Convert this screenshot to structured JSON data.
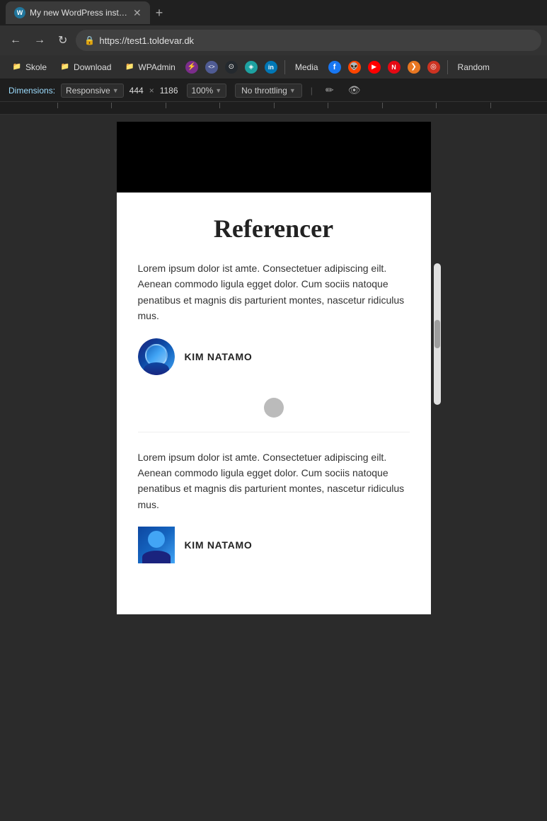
{
  "browser": {
    "tab": {
      "favicon_label": "W",
      "title": "My new WordPress installation"
    },
    "nav": {
      "url": "https://test1.toldevar.dk",
      "back_label": "←",
      "forward_label": "→",
      "refresh_label": "↻",
      "lock_icon": "🔒"
    },
    "bookmarks": [
      {
        "id": "skole",
        "type": "folder",
        "label": "Skole"
      },
      {
        "id": "download",
        "type": "folder",
        "label": "Download"
      },
      {
        "id": "wpadmin",
        "type": "folder",
        "label": "WPAdmin"
      },
      {
        "id": "bolt",
        "type": "icon",
        "label": ""
      },
      {
        "id": "php",
        "type": "icon",
        "label": "<>"
      },
      {
        "id": "github",
        "type": "icon",
        "label": ""
      },
      {
        "id": "teal",
        "type": "icon",
        "label": ""
      },
      {
        "id": "linkedin",
        "type": "icon",
        "label": "in"
      },
      {
        "id": "sep1",
        "type": "sep"
      },
      {
        "id": "media",
        "type": "text",
        "label": "Media"
      },
      {
        "id": "facebook",
        "type": "icon",
        "label": "f"
      },
      {
        "id": "reddit",
        "type": "icon",
        "label": ""
      },
      {
        "id": "youtube",
        "type": "icon",
        "label": "▶"
      },
      {
        "id": "netflix",
        "type": "icon",
        "label": "N"
      },
      {
        "id": "orange",
        "type": "icon",
        "label": "❯"
      },
      {
        "id": "red2",
        "type": "icon",
        "label": ""
      },
      {
        "id": "sep2",
        "type": "sep"
      },
      {
        "id": "random",
        "type": "text",
        "label": "Random"
      }
    ],
    "devtools": {
      "dimensions_label": "Dimensions:",
      "responsive_label": "Responsive",
      "width_value": "444",
      "times_label": "×",
      "height_value": "1186",
      "zoom_value": "100%",
      "throttle_label": "No throttling",
      "pen_icon": "✏",
      "eye_icon": "👁"
    }
  },
  "webpage": {
    "title": "Referencer",
    "testimonials": [
      {
        "id": 1,
        "text": "Lorem ipsum dolor ist amte. Consectetuer adipiscing eilt. Aenean commodo ligula egget dolor. Cum sociis natoque penatibus et magnis dis parturient montes, nascetur ridiculus mus.",
        "author_name": "KIM NATAMO",
        "has_spinner": true
      },
      {
        "id": 2,
        "text": "Lorem ipsum dolor ist amte. Consectetuer adipiscing eilt. Aenean commodo ligula egget dolor. Cum sociis natoque penatibus et magnis dis parturient montes, nascetur ridiculus mus.",
        "author_name": "KIM NATAMO",
        "has_spinner": false
      }
    ]
  }
}
